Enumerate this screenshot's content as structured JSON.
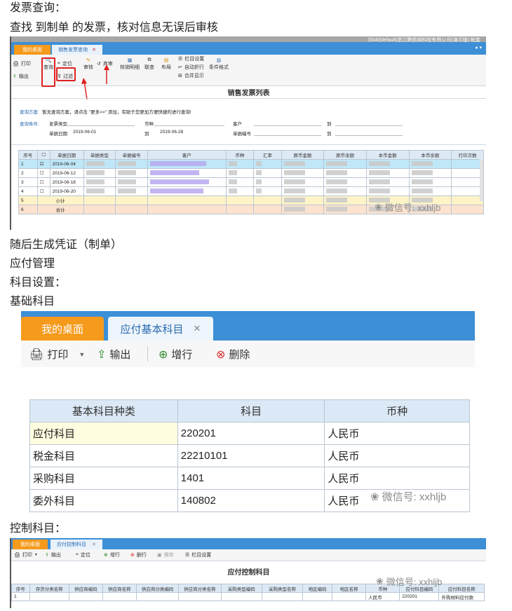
{
  "lines": {
    "l1": "发票查询：",
    "l2": "查找 到制单 的发票，核对信息无误后审核",
    "l3": "随后生成凭证（制单）",
    "l4": "应付管理",
    "l5": "科目设置：",
    "l6": "基础科目",
    "l7": "控制科目："
  },
  "watermark": "微信号: xxhljb",
  "s1": {
    "title_right": "[004](default)浙江腾凯纯科技有限公司(演示版)  帐套",
    "tab_home": "我的桌面",
    "tab_active": "销售发票查询",
    "toolbar": {
      "print": "打印",
      "export": "输出",
      "query": "查询",
      "locate": "定位",
      "filter": "过滤",
      "audit": "审核",
      "abandon": "弃审",
      "detail": "核销明细",
      "link": "联查",
      "layout": "布局",
      "column_set": "栏目设置",
      "auto_fold": "自动折行",
      "merge_show": "合并显示",
      "cond_format": "条件格式"
    },
    "page_title": "销售发票列表",
    "plan_label": "查询方案:",
    "plan_text": "暂无查询方案，请点击 \"更多>>\" 添加，有助于您更加方便快捷的进行查询!",
    "cond_label": "查询条件:",
    "cond": {
      "invoice_type": "发票类型",
      "currency": "币种",
      "customer": "客户",
      "to1": "到",
      "bill_date": "单据日期",
      "date_from": "2019-06-01",
      "to2": "到",
      "date_to": "2019-06-28",
      "bill_no": "单据编号",
      "to3": "到"
    },
    "headers": [
      "序号",
      "",
      "单据日期",
      "单据类型",
      "单据编号",
      "客户",
      "币种",
      "汇率",
      "原币金额",
      "原币余额",
      "本币金额",
      "本币余额",
      "打印次数"
    ],
    "rows": [
      {
        "no": "1",
        "checked": true,
        "date": "2019-06-04"
      },
      {
        "no": "2",
        "checked": false,
        "date": "2019-06-12"
      },
      {
        "no": "3",
        "checked": false,
        "date": "2019-06-18"
      },
      {
        "no": "4",
        "checked": false,
        "date": "2019-06-20"
      }
    ],
    "subtotal": {
      "no": "5",
      "label": "小计"
    },
    "total": {
      "no": "6",
      "label": "合计"
    }
  },
  "s2": {
    "tab_home": "我的桌面",
    "tab_active": "应付基本科目",
    "toolbar": {
      "print": "打印",
      "export": "输出",
      "add": "增行",
      "delete": "删除"
    },
    "headers": [
      "基本科目种类",
      "科目",
      "币种"
    ],
    "rows": [
      [
        "应付科目",
        "220201",
        "人民币"
      ],
      [
        "税金科目",
        "22210101",
        "人民币"
      ],
      [
        "采购科目",
        "1401",
        "人民币"
      ],
      [
        "委外科目",
        "140802",
        "人民币"
      ]
    ]
  },
  "s3": {
    "tab_home": "我的桌面",
    "tab_active": "应付控制科目",
    "toolbar": {
      "print": "打印",
      "export": "输出",
      "locate": "定位",
      "add": "增行",
      "delete": "删行",
      "save": "保存",
      "column_set": "栏目设置"
    },
    "page_title": "应付控制科目",
    "headers": [
      "序号",
      "存货分类名称",
      "供应商编码",
      "供应商名称",
      "供应商分类编码",
      "供应商分类名称",
      "采购类型编码",
      "采购类型名称",
      "地区编码",
      "地区名称",
      "币种",
      "应付科目编码",
      "应付科目名称"
    ],
    "row": [
      "1",
      "",
      "",
      "",
      "",
      "",
      "",
      "",
      "",
      "",
      "人民币",
      "220201",
      "外购材料应付款"
    ]
  }
}
